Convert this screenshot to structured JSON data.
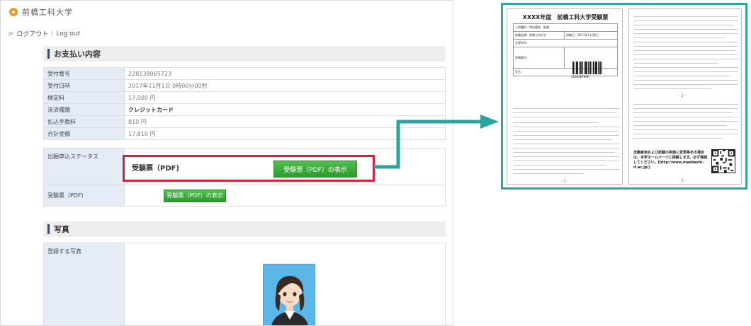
{
  "site": {
    "logo_text": "前橋工科大学"
  },
  "nav": {
    "arrow": "≫",
    "logout_label": "ログアウト",
    "separator": "/",
    "logout_en": "Log out"
  },
  "payment": {
    "title": "お支払い内容",
    "rows": [
      {
        "label": "受付番号",
        "value": "228138065723"
      },
      {
        "label": "受付日時",
        "value": "2017年11月1日 0時00分00秒"
      },
      {
        "label": "検定料",
        "value": "17,000 円"
      },
      {
        "label": "決済種類",
        "value": "クレジットカード"
      },
      {
        "label": "払込手数料",
        "value": "810 円"
      },
      {
        "label": "合計金額",
        "value": "17,810 円"
      }
    ]
  },
  "status": {
    "label": "出願申込ステータス",
    "ticket_label": "受験票（PDF）",
    "show_button": "受験票（PDF）の表示"
  },
  "callout": {
    "label": "受験票（PDF)",
    "button": "受験票（PDF）の表示"
  },
  "photo": {
    "section_title": "写真",
    "label": "登録する写真"
  },
  "ticket": {
    "title": "XXXX年度　前橋工科大学受験票",
    "rows": [
      [
        "入試種別：特別選抜　推薦"
      ],
      [
        "試験会場：前橋工科大学",
        "試験日：2017年11月8日"
      ],
      [
        "志望学科："
      ],
      [
        "受験番号："
      ],
      [
        "氏名："
      ]
    ],
    "barcode_digits": "1234567890",
    "qr_note": "志願者用および試験の実施に変更等ある場合は、本学ホームページに掲載します。必ず確認してください。[http://www.maebashi-it.ac.jp/]"
  },
  "colors": {
    "accent_teal": "#2aa5a0",
    "highlight_red": "#d6203a",
    "button_green": "#3aa83a",
    "header_navy": "#2b4a7d"
  }
}
